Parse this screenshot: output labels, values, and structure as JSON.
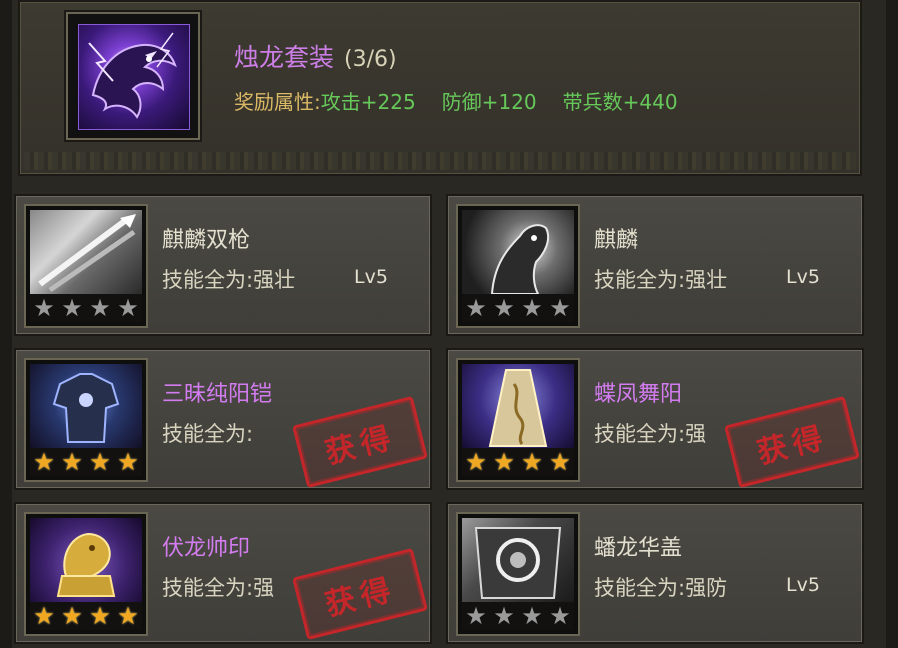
{
  "set": {
    "title": "烛龙套装",
    "count": "(3/6)",
    "attr_label": "奖励属性:",
    "attrs": [
      "攻击+225",
      "防御+120",
      "带兵数+440"
    ]
  },
  "items": [
    {
      "name": "麒麟双枪",
      "skill": "技能全为:强壮",
      "level": "Lv5",
      "quality": "white",
      "obtained": false,
      "stars": 4
    },
    {
      "name": "麒麟",
      "skill": "技能全为:强壮",
      "level": "Lv5",
      "quality": "white",
      "obtained": false,
      "stars": 4
    },
    {
      "name": "三昧纯阳铠",
      "skill": "技能全为:",
      "level": "",
      "quality": "purple",
      "obtained": true,
      "stars": 4
    },
    {
      "name": "蝶凤舞阳",
      "skill": "技能全为:强",
      "level": "",
      "quality": "purple",
      "obtained": true,
      "stars": 4
    },
    {
      "name": "伏龙帅印",
      "skill": "技能全为:强",
      "level": "",
      "quality": "purple",
      "obtained": true,
      "stars": 4
    },
    {
      "name": "蟠龙华盖",
      "skill": "技能全为:强防",
      "level": "Lv5",
      "quality": "white",
      "obtained": false,
      "stars": 4
    }
  ],
  "stamp_text": "获得",
  "star_glyph": "★",
  "colors": {
    "purple_name": "#d37cf0",
    "set_title": "#cc7ee6",
    "attr_green": "#67c85a",
    "attr_label": "#d9b866",
    "stamp_red": "#c4262a",
    "star_gold": "#f0a822"
  }
}
